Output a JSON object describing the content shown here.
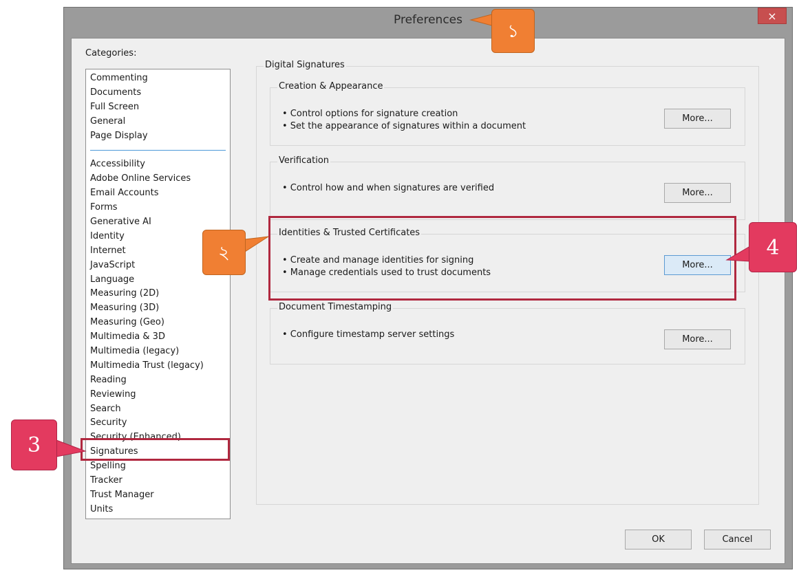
{
  "window": {
    "title": "Preferences",
    "close_icon": "×"
  },
  "categories": {
    "label": "Categories:",
    "group1": [
      "Commenting",
      "Documents",
      "Full Screen",
      "General",
      "Page Display"
    ],
    "group2": [
      "Accessibility",
      "Adobe Online Services",
      "Email Accounts",
      "Forms",
      "Generative AI",
      "Identity",
      "Internet",
      "JavaScript",
      "Language",
      "Measuring (2D)",
      "Measuring (3D)",
      "Measuring (Geo)",
      "Multimedia & 3D",
      "Multimedia (legacy)",
      "Multimedia Trust (legacy)",
      "Reading",
      "Reviewing",
      "Search",
      "Security",
      "Security (Enhanced)",
      "Signatures",
      "Spelling",
      "Tracker",
      "Trust Manager",
      "Units"
    ],
    "selected": "Signatures"
  },
  "panel": {
    "title": "Digital Signatures",
    "sections": [
      {
        "title": "Creation & Appearance",
        "lines": [
          "• Control options for signature creation",
          "• Set the appearance of signatures within a document"
        ],
        "button": "More..."
      },
      {
        "title": "Verification",
        "lines": [
          "• Control how and when signatures are verified"
        ],
        "button": "More..."
      },
      {
        "title": "Identities & Trusted Certificates",
        "lines": [
          "• Create and manage identities for signing",
          "• Manage credentials used to trust documents"
        ],
        "button": "More..."
      },
      {
        "title": "Document Timestamping",
        "lines": [
          "• Configure timestamp server settings"
        ],
        "button": "More..."
      }
    ]
  },
  "footer": {
    "ok": "OK",
    "cancel": "Cancel"
  },
  "callouts": {
    "c1": "১",
    "c2": "২",
    "c3": "3",
    "c4": "4"
  },
  "colors": {
    "callout_orange": "#f07f33",
    "callout_red": "#e33a5f",
    "highlight": "#b0283f",
    "selected_separator": "#4a98d8"
  }
}
